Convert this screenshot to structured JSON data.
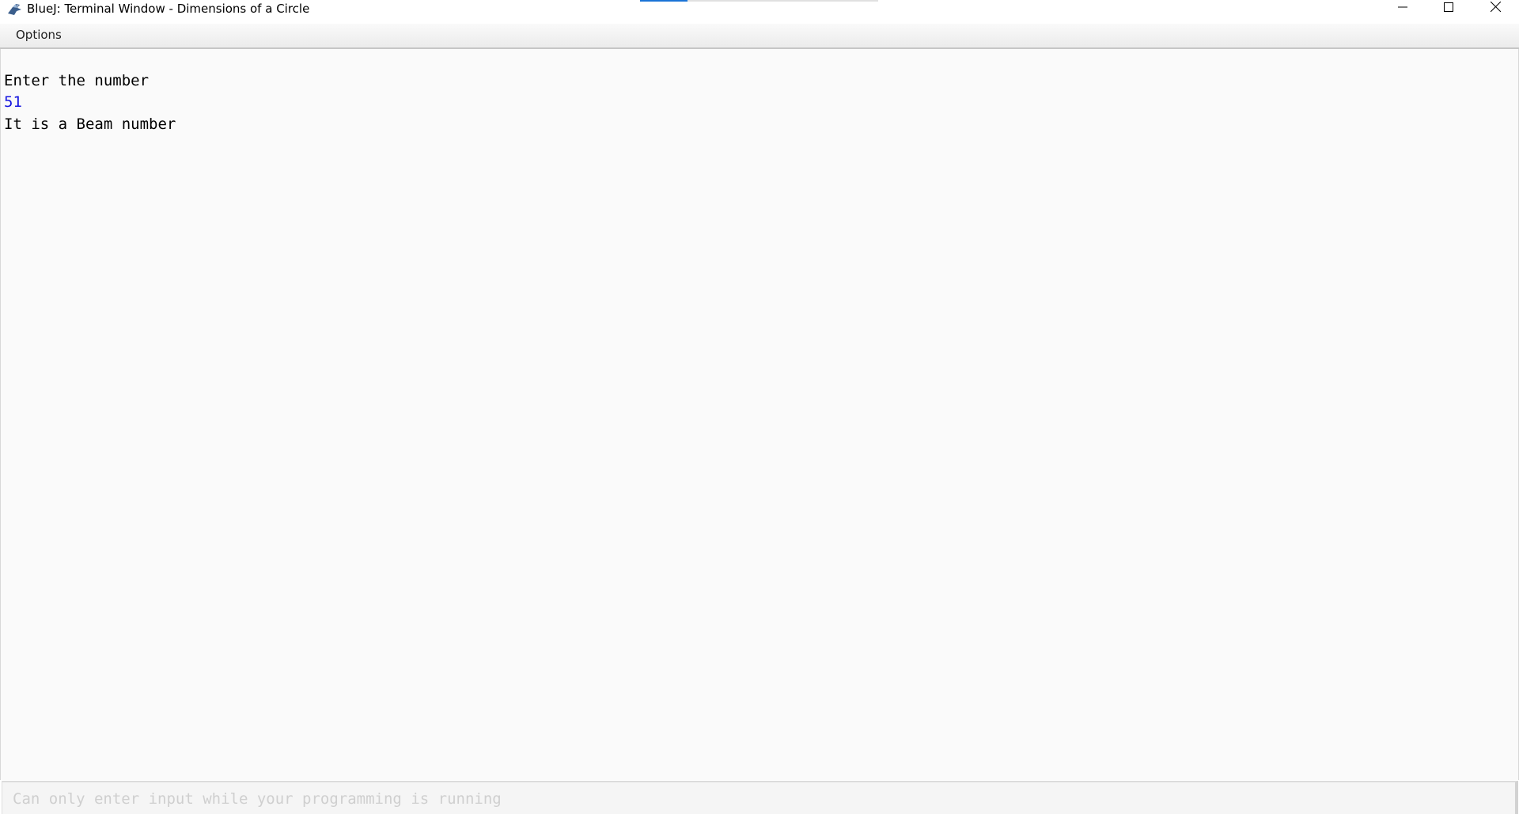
{
  "window": {
    "title": "BlueJ: Terminal Window - Dimensions of a Circle",
    "app_icon": "bluej-bird-icon",
    "progress_fraction": 0.2,
    "controls": [
      "minimize-icon",
      "maximize-icon",
      "close-icon"
    ]
  },
  "menubar": {
    "items": [
      {
        "label": "Options"
      }
    ]
  },
  "terminal": {
    "lines": [
      {
        "text": "Enter the number",
        "kind": "output"
      },
      {
        "text": "51",
        "kind": "input-echo"
      },
      {
        "text": "It is a Beam number",
        "kind": "output"
      }
    ],
    "colors": {
      "output": "#000000",
      "input_echo": "#1515e0"
    }
  },
  "input_bar": {
    "value": "",
    "placeholder": "Can only enter input while your programming is running"
  }
}
